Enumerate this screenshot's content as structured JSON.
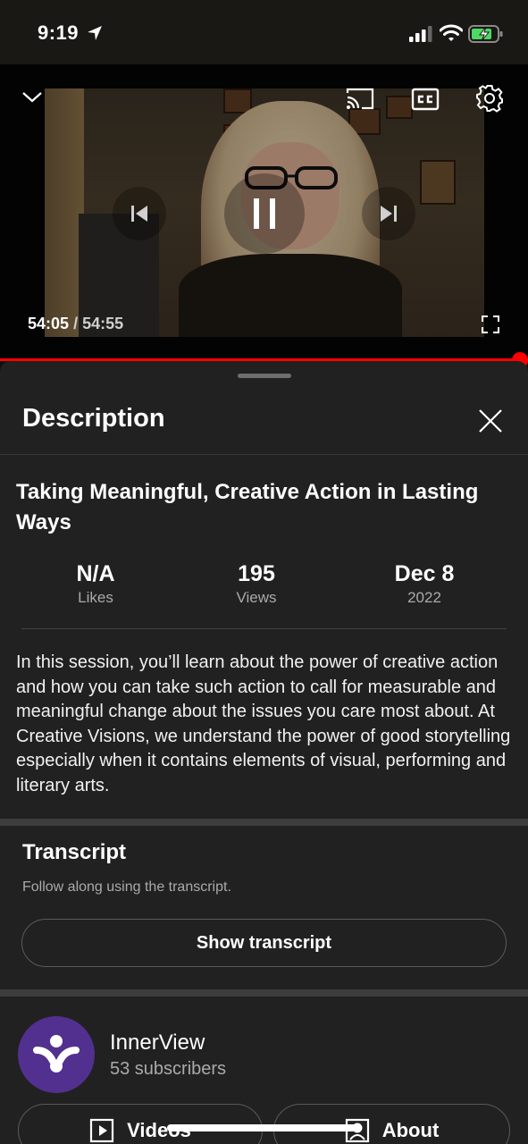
{
  "status_bar": {
    "time": "9:19",
    "icons": [
      "location-arrow-icon",
      "cellular-signal-icon",
      "wifi-icon",
      "battery-charging-icon"
    ]
  },
  "player": {
    "current_time": "54:05",
    "duration": "/ 54:55",
    "progress_fraction": 0.984,
    "controls": [
      "collapse-icon",
      "cast-icon",
      "closed-captions-icon",
      "settings-gear-icon",
      "previous-icon",
      "pause-icon",
      "next-icon",
      "fullscreen-icon"
    ],
    "accent_color": "#ff0000"
  },
  "description_panel": {
    "title": "Description",
    "video_title": "Taking Meaningful, Creative Action in Lasting Ways",
    "stats": {
      "likes_value": "N/A",
      "likes_label": "Likes",
      "views_value": "195",
      "views_label": "Views",
      "date_value": "Dec 8",
      "date_label": "2022"
    },
    "body": "In this session, you’ll learn about the power of creative action and how you can take such action to call for measurable and meaningful change about the issues you care most about. At Creative Visions, we understand the power of good storytelling especially when it contains elements of visual, performing and literary arts."
  },
  "transcript": {
    "title": "Transcript",
    "subtitle": "Follow along using the transcript.",
    "button_label": "Show transcript"
  },
  "channel": {
    "name": "InnerView",
    "subscribers": "53 subscribers",
    "avatar_color": "#52308f",
    "videos_label": "Videos",
    "about_label": "About"
  }
}
